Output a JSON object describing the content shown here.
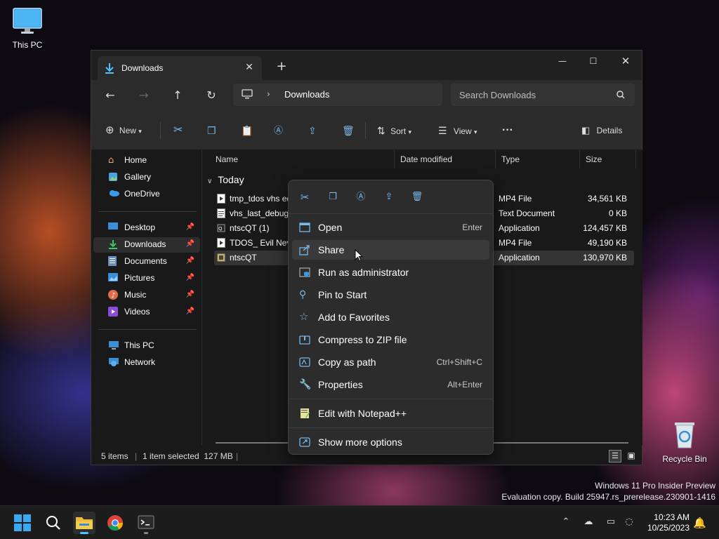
{
  "desktop": {
    "icons": [
      {
        "label": "This PC"
      },
      {
        "label": "Recycle Bin"
      }
    ],
    "watermark": {
      "line1": "Windows 11 Pro Insider Preview",
      "line2": "Evaluation copy. Build 25947.rs_prerelease.230901-1416"
    }
  },
  "window": {
    "tab_title": "Downloads",
    "address": {
      "crumb": "Downloads"
    },
    "search_placeholder": "Search Downloads",
    "toolbar": {
      "new_label": "New",
      "sort_label": "Sort",
      "view_label": "View",
      "details_label": "Details"
    },
    "sidebar": {
      "items": [
        {
          "label": "Home",
          "icon": "home-icon",
          "pinned": false,
          "selected": false
        },
        {
          "label": "Gallery",
          "icon": "gallery-icon",
          "pinned": false,
          "selected": false
        },
        {
          "label": "OneDrive",
          "icon": "onedrive-icon",
          "pinned": false,
          "selected": false
        },
        {
          "label": "Desktop",
          "icon": "desktop-icon",
          "pinned": true,
          "selected": false
        },
        {
          "label": "Downloads",
          "icon": "downloads-icon",
          "pinned": true,
          "selected": true
        },
        {
          "label": "Documents",
          "icon": "documents-icon",
          "pinned": true,
          "selected": false
        },
        {
          "label": "Pictures",
          "icon": "pictures-icon",
          "pinned": true,
          "selected": false
        },
        {
          "label": "Music",
          "icon": "music-icon",
          "pinned": true,
          "selected": false
        },
        {
          "label": "Videos",
          "icon": "videos-icon",
          "pinned": true,
          "selected": false
        },
        {
          "label": "This PC",
          "icon": "this-pc-icon",
          "pinned": false,
          "selected": false
        },
        {
          "label": "Network",
          "icon": "network-icon",
          "pinned": false,
          "selected": false
        }
      ]
    },
    "columns": {
      "name": "Name",
      "date": "Date modified",
      "type": "Type",
      "size": "Size"
    },
    "group_label": "Today",
    "files": [
      {
        "name": "tmp_tdos vhs ed",
        "type": "MP4 File",
        "size": "34,561 KB",
        "selected": false
      },
      {
        "name": "vhs_last_debug_",
        "type": "Text Document",
        "size": "0 KB",
        "selected": false
      },
      {
        "name": "ntscQT (1)",
        "type": "Application",
        "size": "124,457 KB",
        "selected": false
      },
      {
        "name": "TDOS_ Evil Neve",
        "type": "MP4 File",
        "size": "49,190 KB",
        "selected": false
      },
      {
        "name": "ntscQT",
        "type": "Application",
        "size": "130,970 KB",
        "selected": true
      }
    ],
    "status": {
      "items": "5 items",
      "selected": "1 item selected  127 MB"
    }
  },
  "context_menu": {
    "items": [
      {
        "label": "Open",
        "shortcut": "Enter",
        "icon": "open-icon"
      },
      {
        "label": "Share",
        "shortcut": "",
        "icon": "share-icon"
      },
      {
        "label": "Run as administrator",
        "shortcut": "",
        "icon": "shield-icon"
      },
      {
        "label": "Pin to Start",
        "shortcut": "",
        "icon": "pin-icon"
      },
      {
        "label": "Add to Favorites",
        "shortcut": "",
        "icon": "star-icon"
      },
      {
        "label": "Compress to ZIP file",
        "shortcut": "",
        "icon": "zip-icon"
      },
      {
        "label": "Copy as path",
        "shortcut": "Ctrl+Shift+C",
        "icon": "copy-path-icon"
      },
      {
        "label": "Properties",
        "shortcut": "Alt+Enter",
        "icon": "wrench-icon"
      },
      {
        "label": "Edit with Notepad++",
        "shortcut": "",
        "icon": "notepadpp-icon"
      },
      {
        "label": "Show more options",
        "shortcut": "",
        "icon": "more-options-icon"
      }
    ]
  },
  "taskbar": {
    "time": "10:23 AM",
    "date": "10/25/2023"
  },
  "colors": {
    "accent": "#4cc2ff",
    "window_bg": "#191919",
    "toolbar_bg": "#2b2b2b",
    "menu_bg": "#2c2c2c"
  }
}
